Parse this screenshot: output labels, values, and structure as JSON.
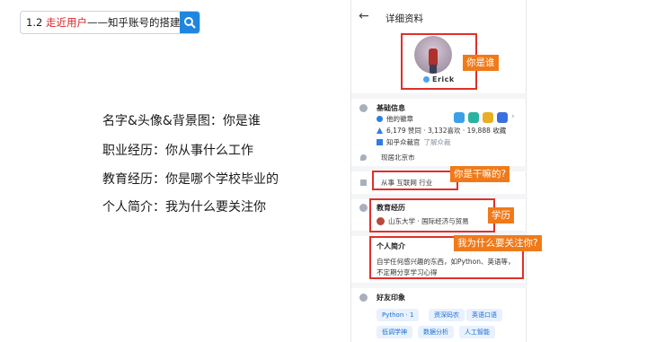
{
  "search": {
    "prefix": "1.2 ",
    "highlight": "走近用户",
    "suffix": "——知乎账号的搭建"
  },
  "left_list": [
    "名字&头像&背景图：你是谁",
    "职业经历：你从事什么工作",
    "教育经历：你是哪个学校毕业的",
    "个人简介：我为什么要关注你"
  ],
  "profile": {
    "header_title": "详细资料",
    "nickname": "Erick",
    "basic_title": "基础信息",
    "medals_label": "他的徽章",
    "stats": "6,179 赞同 · 3,132喜欢 · 19,888 收藏",
    "zhihu_edu": "知乎众裁官",
    "zhihu_edu_link": "了解众裁",
    "location": "现居北京市",
    "industry": "从事 互联网 行业",
    "edu_title": "教育经历",
    "school": "山东大学 · 国际经济与贸易",
    "intro_title": "个人简介",
    "intro_text": "自学任何感兴趣的东西，如Python、英语等，不定期分享学习心得",
    "friends_title": "好友印象",
    "tags": [
      "Python · 1",
      "资深码农",
      "英语口语",
      "低调学神",
      "数据分析",
      "人工智能"
    ]
  },
  "annotations": {
    "who": "你是谁",
    "job": "你是干嘛的?",
    "edu": "学历",
    "why": "我为什么要关注你?"
  },
  "colors": {
    "accent_blue": "#1e86e0",
    "highlight_red": "#e02020",
    "annotation_orange": "#f07a1a",
    "box_red": "#e0302a"
  }
}
